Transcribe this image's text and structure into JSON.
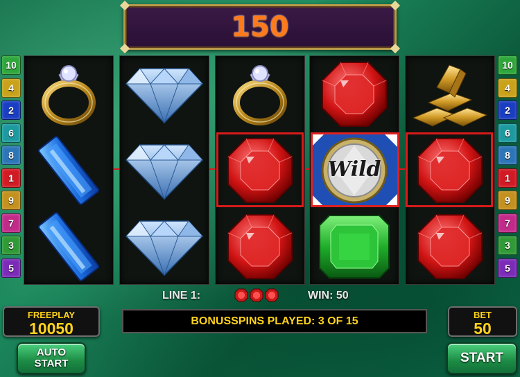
{
  "win_display": {
    "value": "150"
  },
  "line_numbers_left": [
    {
      "label": "10",
      "color": "#2ea63a"
    },
    {
      "label": "4",
      "color": "#c9a21a"
    },
    {
      "label": "2",
      "color": "#1a3ec2"
    },
    {
      "label": "6",
      "color": "#1c9aa0"
    },
    {
      "label": "8",
      "color": "#2c76b8"
    },
    {
      "label": "1",
      "color": "#d21a24"
    },
    {
      "label": "9",
      "color": "#c4911e"
    },
    {
      "label": "7",
      "color": "#c22a8a"
    },
    {
      "label": "3",
      "color": "#2f9a36"
    },
    {
      "label": "5",
      "color": "#7b2bb8"
    }
  ],
  "line_numbers_right": [
    {
      "label": "10",
      "color": "#2ea63a"
    },
    {
      "label": "4",
      "color": "#c9a21a"
    },
    {
      "label": "2",
      "color": "#1a3ec2"
    },
    {
      "label": "6",
      "color": "#1c9aa0"
    },
    {
      "label": "8",
      "color": "#2c76b8"
    },
    {
      "label": "1",
      "color": "#d21a24"
    },
    {
      "label": "9",
      "color": "#c4911e"
    },
    {
      "label": "7",
      "color": "#c22a8a"
    },
    {
      "label": "3",
      "color": "#2f9a36"
    },
    {
      "label": "5",
      "color": "#7b2bb8"
    }
  ],
  "reels": [
    [
      "ring-icon",
      "sapphire-icon",
      "sapphire-icon"
    ],
    [
      "diamond-icon",
      "diamond-icon",
      "diamond-icon"
    ],
    [
      "ring-icon",
      "ruby-icon",
      "ruby-icon"
    ],
    [
      "ruby-icon",
      "wild-icon",
      "emerald-icon"
    ],
    [
      "gold-bars-icon",
      "ruby-icon",
      "ruby-icon"
    ]
  ],
  "wild_text": "Wild",
  "status": {
    "line_label": "LINE 1:",
    "win_label": "WIN: 50"
  },
  "freeplay": {
    "label": "FREEPLAY",
    "value": "10050"
  },
  "bet": {
    "label": "BET",
    "value": "50"
  },
  "bonus_bar": {
    "text": "BONUSSPINS PLAYED: 3 OF 15"
  },
  "buttons": {
    "auto_start_line1": "AUTO",
    "auto_start_line2": "START",
    "start": "START"
  },
  "colors": {
    "highlight": "#d81b1b",
    "accent_yellow": "#ffd21c",
    "win_orange": "#ff7a1a"
  }
}
